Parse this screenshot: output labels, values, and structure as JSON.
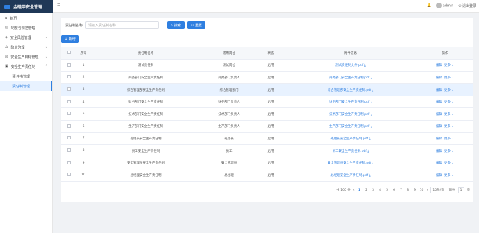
{
  "app": {
    "title": "金硅甲安全管理"
  },
  "topbar": {
    "user": "admin",
    "logout": "退出登录"
  },
  "sidebar": {
    "items": [
      {
        "label": "首页"
      },
      {
        "label": "制度与规范管理"
      },
      {
        "label": "安全风险管理"
      },
      {
        "label": "隐患治理"
      },
      {
        "label": "安全生产目标管理"
      },
      {
        "label": "安全生产责任制"
      }
    ],
    "sub_items": [
      {
        "label": "责任书管理"
      },
      {
        "label": "责任制管理"
      }
    ]
  },
  "search": {
    "label": "责任制名称",
    "placeholder": "请输入责任制名称",
    "search_button": "搜索",
    "reset_button": "重置"
  },
  "toolbar": {
    "add_label": "+ 新增"
  },
  "table": {
    "headers": [
      "序号",
      "责任制名称",
      "适用岗位",
      "状态",
      "附件信息",
      "操作"
    ],
    "rows": [
      {
        "no": "1",
        "name": "测试责任制",
        "post": "测试岗位",
        "status": "启用",
        "file": "测试责任制文件.pdf"
      },
      {
        "no": "2",
        "name": "商务部门安全生产责任制",
        "post": "商务部门负责人",
        "status": "启用",
        "file": "商务部门安全生产责任制.pdf"
      },
      {
        "no": "3",
        "name": "综合管理部安全生产责任制",
        "post": "综合管理部门",
        "status": "启用",
        "file": "综合管理部安全生产责任制.pdf"
      },
      {
        "no": "4",
        "name": "财务部门安全生产责任制",
        "post": "财务部门负责人",
        "status": "启用",
        "file": "财务部门安全生产责任制.pdf"
      },
      {
        "no": "5",
        "name": "技术部门安全生产责任制",
        "post": "技术部门负责人",
        "status": "启用",
        "file": "技术部门安全生产责任制.pdf"
      },
      {
        "no": "6",
        "name": "生产部门安全生产责任制",
        "post": "生产部门负责人",
        "status": "启用",
        "file": "生产部门安全生产责任制.pdf"
      },
      {
        "no": "7",
        "name": "班组长安全生产责任制",
        "post": "班组长",
        "status": "启用",
        "file": "班组长安全生产责任制.pdf"
      },
      {
        "no": "8",
        "name": "员工安全生产责任制",
        "post": "员工",
        "status": "启用",
        "file": "员工安全生产责任制.pdf"
      },
      {
        "no": "9",
        "name": "安全管理员安全生产责任制",
        "post": "安全管理员",
        "status": "启用",
        "file": "安全管理员安全生产责任制.pdf"
      },
      {
        "no": "10",
        "name": "总经理安全生产责任制",
        "post": "总经理",
        "status": "启用",
        "file": "总经理安全生产责任制.pdf"
      }
    ],
    "edit_label": "编辑",
    "more_label": "更多"
  },
  "pager": {
    "total": "共 100 条",
    "pages": [
      "1",
      "2",
      "3",
      "4",
      "5",
      "6",
      "7",
      "8",
      "9",
      "10"
    ],
    "page_size": "10条/页",
    "goto": "前往",
    "goto_value": "1",
    "page_unit": "页"
  },
  "colors": {
    "accent": "#2f7fe0",
    "sidebar_dark": "#1f3857"
  }
}
